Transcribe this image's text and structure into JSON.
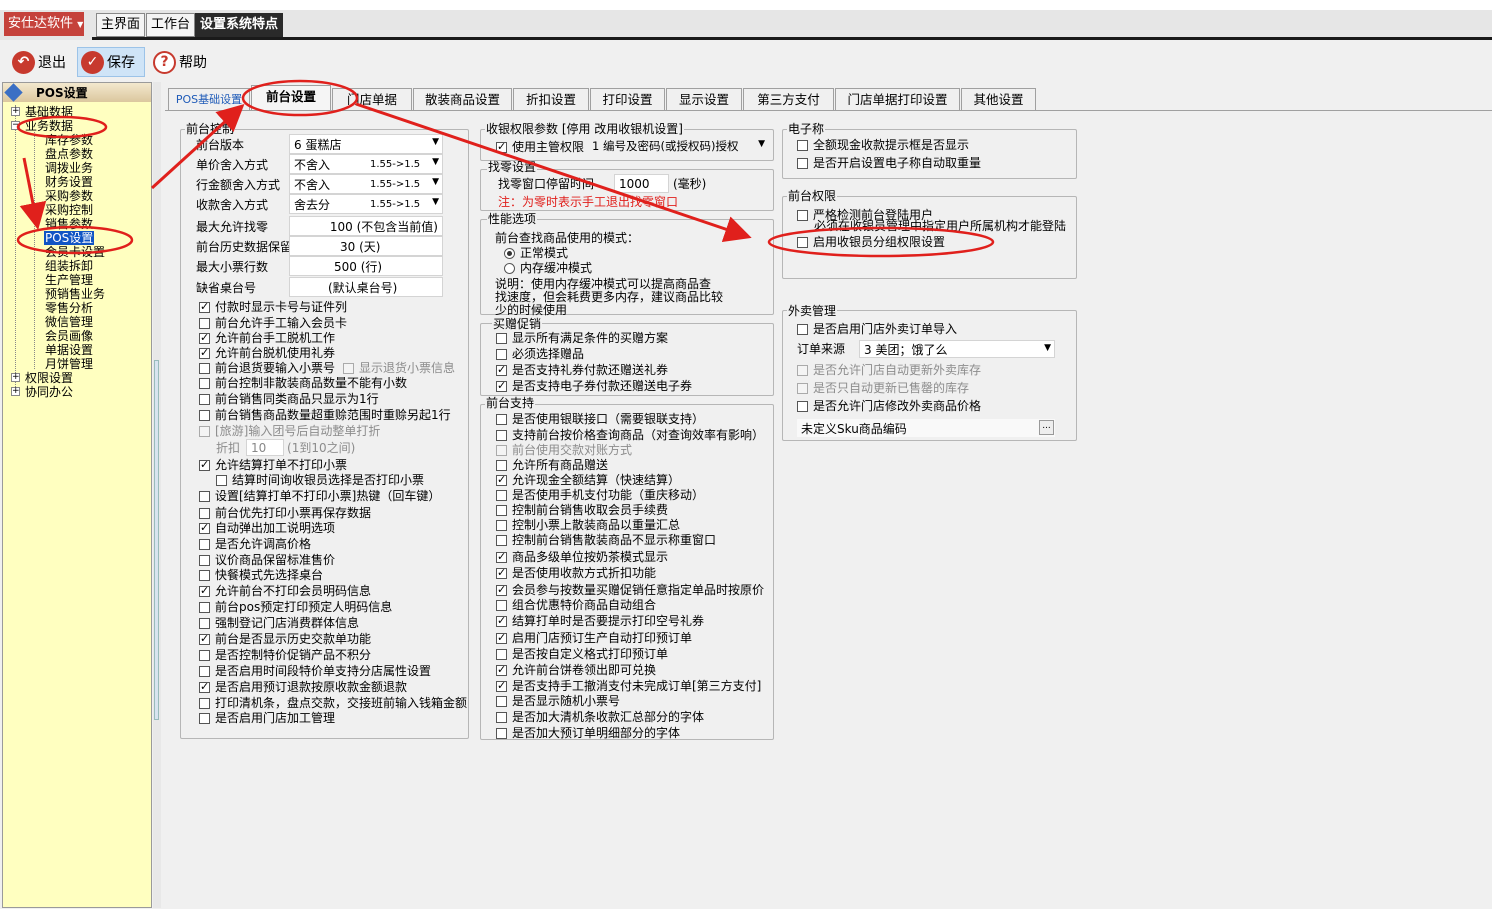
{
  "title_bar": {
    "text": ""
  },
  "brand": {
    "label": "安仕达软件"
  },
  "module_tabs": [
    {
      "label": "主界面"
    },
    {
      "label": "工作台"
    },
    {
      "label": "设置系统特点"
    }
  ],
  "toolbar": {
    "exit": "退出",
    "save": "保存",
    "help": "帮助"
  },
  "sidebar": {
    "title": "POS设置",
    "items": [
      {
        "label": "基础数据"
      },
      {
        "label": "业务数据"
      },
      {
        "label": "库存参数"
      },
      {
        "label": "盘点参数"
      },
      {
        "label": "调拨业务"
      },
      {
        "label": "财务设置"
      },
      {
        "label": "采购参数"
      },
      {
        "label": "采购控制"
      },
      {
        "label": "销售参数"
      },
      {
        "label": "POS设置"
      },
      {
        "label": "会员卡设置"
      },
      {
        "label": "组装拆卸"
      },
      {
        "label": "生产管理"
      },
      {
        "label": "预销售业务"
      },
      {
        "label": "零售分析"
      },
      {
        "label": "微信管理"
      },
      {
        "label": "会员画像"
      },
      {
        "label": "单据设置"
      },
      {
        "label": "月饼管理"
      },
      {
        "label": "权限设置"
      },
      {
        "label": "协同办公"
      }
    ]
  },
  "tabs": [
    {
      "label": "POS基础设置"
    },
    {
      "label": "前台设置"
    },
    {
      "label": "门店单据"
    },
    {
      "label": "散装商品设置"
    },
    {
      "label": "折扣设置"
    },
    {
      "label": "打印设置"
    },
    {
      "label": "显示设置"
    },
    {
      "label": "第三方支付"
    },
    {
      "label": "门店单据打印设置"
    },
    {
      "label": "其他设置"
    }
  ],
  "front_control": {
    "title": "前台控制",
    "fields": [
      {
        "label": "前台版本",
        "value": "6 蛋糕店",
        "extra": ""
      },
      {
        "label": "单价舍入方式",
        "value": "不舍入",
        "extra": "1.55->1.5"
      },
      {
        "label": "行金额舍入方式",
        "value": "不舍入",
        "extra": "1.55->1.5"
      },
      {
        "label": "收款舍入方式",
        "value": "舍去分",
        "extra": "1.55->1.5"
      },
      {
        "label": "最大允许找零",
        "value": "100 (不包含当前值)"
      },
      {
        "label": "前台历史数据保留",
        "value": "30 (天)"
      },
      {
        "label": "最大小票行数",
        "value": "500 (行)"
      },
      {
        "label": "缺省桌台号",
        "value": "(默认桌台号)"
      }
    ],
    "checks": [
      {
        "label": "付款时显示卡号与证件列",
        "checked": true
      },
      {
        "label": "前台允许手工输入会员卡",
        "checked": false
      },
      {
        "label": "允许前台手工脱机工作",
        "checked": true
      },
      {
        "label": "允许前台脱机使用礼券",
        "checked": true
      },
      {
        "label": "前台退货要输入小票号",
        "checked": false
      },
      {
        "label": "显示退货小票信息",
        "checked": false
      },
      {
        "label": "前台控制非散装商品数量不能有小数",
        "checked": false
      },
      {
        "label": "前台销售同类商品只显示为1行",
        "checked": false
      },
      {
        "label": "前台销售商品数量超重赊范围时重赊另起1行",
        "checked": false
      },
      {
        "label": "[旅游]输入团号后自动整单打折",
        "checked": false
      },
      {
        "label": "允许结算打单不打印小票",
        "checked": true
      },
      {
        "label": "结算时间询收银员选择是否打印小票",
        "checked": false
      },
      {
        "label": "设置[结算打单不打印小票]热键（回车键）",
        "checked": false
      },
      {
        "label": "前台优先打印小票再保存数据",
        "checked": false
      },
      {
        "label": "自动弹出加工说明选项",
        "checked": true
      },
      {
        "label": "是否允许调高价格",
        "checked": false
      },
      {
        "label": "议价商品保留标准售价",
        "checked": false
      },
      {
        "label": "快餐模式先选择桌台",
        "checked": false
      },
      {
        "label": "允许前台不打印会员明码信息",
        "checked": true
      },
      {
        "label": "前台pos预定打印预定人明码信息",
        "checked": false
      },
      {
        "label": "强制登记门店消费群体信息",
        "checked": false
      },
      {
        "label": "前台是否显示历史交款单功能",
        "checked": true
      },
      {
        "label": "是否控制特价促销产品不积分",
        "checked": false
      },
      {
        "label": "是否启用时间段特价单支持分店属性设置",
        "checked": false
      },
      {
        "label": "是否启用预订退款按原收款金额退款",
        "checked": true
      },
      {
        "label": "打印清机条，盘点交款，交接班前输入钱箱金额",
        "checked": false
      },
      {
        "label": "是否启用门店加工管理",
        "checked": false
      }
    ],
    "discount": {
      "label": "折扣",
      "value": "10",
      "hint": "(1到10之间)"
    }
  },
  "cashier_perm": {
    "title": "收银权限参数 [停用  改用收银机设置]",
    "label": "使用主管权限",
    "checked": true,
    "value": "1 编号及密码(或授权码)授权"
  },
  "change": {
    "title": "找零设置",
    "label": "找零窗口停留时间",
    "value": "1000",
    "unit": "(毫秒)",
    "note": "注：为零时表示手工退出找零窗口"
  },
  "perf": {
    "title": "性能选项",
    "desc": "前台查找商品使用的模式：",
    "options": [
      {
        "label": "正常模式",
        "selected": true
      },
      {
        "label": "内存缓冲模式",
        "selected": false
      }
    ],
    "note": [
      "说明：使用内存缓冲模式可以提高商品查",
      "找速度，但会耗费更多内存，建议商品比较",
      "少的时候使用"
    ]
  },
  "gift_promo": {
    "title": "买赠促销",
    "checks": [
      {
        "label": "显示所有满足条件的买赠方案",
        "checked": false
      },
      {
        "label": "必须选择赠品",
        "checked": false
      },
      {
        "label": "是否支持礼券付款还赠送礼券",
        "checked": true
      },
      {
        "label": "是否支持电子券付款还赠送电子券",
        "checked": true
      }
    ]
  },
  "front_support": {
    "title": "前台支持",
    "checks": [
      {
        "label": "是否使用银联接口（需要银联支持）",
        "checked": false,
        "disabled": false
      },
      {
        "label": "支持前台按价格查询商品（对查询效率有影响）",
        "checked": false,
        "disabled": false
      },
      {
        "label": "前台使用交款对账方式",
        "checked": false,
        "disabled": true
      },
      {
        "label": "允许所有商品赠送",
        "checked": false,
        "disabled": false
      },
      {
        "label": "允许现金全额结算（快速结算）",
        "checked": true,
        "disabled": false
      },
      {
        "label": "是否使用手机支付功能（重庆移动）",
        "checked": false,
        "disabled": false
      },
      {
        "label": "控制前台销售收取会员手续费",
        "checked": false,
        "disabled": false
      },
      {
        "label": "控制小票上散装商品以重量汇总",
        "checked": false,
        "disabled": false
      },
      {
        "label": "控制前台销售散装商品不显示称重窗口",
        "checked": false,
        "disabled": false
      },
      {
        "label": "商品多级单位按奶茶模式显示",
        "checked": true,
        "disabled": false
      },
      {
        "label": "是否使用收款方式折扣功能",
        "checked": true,
        "disabled": false
      },
      {
        "label": "会员参与按数量买赠促销任意指定单品时按原价",
        "checked": true,
        "disabled": false
      },
      {
        "label": "组合优惠特价商品自动组合",
        "checked": false,
        "disabled": false
      },
      {
        "label": "结算打单时是否要提示打印空号礼券",
        "checked": true,
        "disabled": false
      },
      {
        "label": "启用门店预订生产自动打印预订单",
        "checked": true,
        "disabled": false
      },
      {
        "label": "是否按自定义格式打印预订单",
        "checked": false,
        "disabled": false
      },
      {
        "label": "允许前台饼卷领出即可兑换",
        "checked": true,
        "disabled": false
      },
      {
        "label": "是否支持手工撤消支付未完成订单[第三方支付]",
        "checked": true,
        "disabled": false
      },
      {
        "label": "是否显示随机小票号",
        "checked": false,
        "disabled": false
      },
      {
        "label": "是否加大清机条收款汇总部分的字体",
        "checked": false,
        "disabled": false
      },
      {
        "label": "是否加大预订单明细部分的字体",
        "checked": false,
        "disabled": false
      }
    ]
  },
  "scale": {
    "title": "电子称",
    "checks": [
      {
        "label": "全额现金收款提示框是否显示",
        "checked": false
      },
      {
        "label": "是否开启设置电子称自动取重量",
        "checked": false
      }
    ]
  },
  "front_perm": {
    "title": "前台权限",
    "checks": [
      {
        "label": "严格检测前台登陆用户",
        "checked": false
      },
      {
        "label": "启用收银员分组权限设置",
        "checked": false
      }
    ],
    "note": "必须在收银员管理中指定用户所属机构才能登陆"
  },
  "takeout": {
    "title": "外卖管理",
    "import": {
      "label": "是否启用门店外卖订单导入",
      "checked": false
    },
    "order_source": {
      "label": "订单来源",
      "value": "3 美团；饿了么"
    },
    "checks": [
      {
        "label": "是否允许门店自动更新外卖库存",
        "checked": false,
        "disabled": true
      },
      {
        "label": "是否只自动更新已售罄的库存",
        "checked": false,
        "disabled": true
      },
      {
        "label": "是否允许门店修改外卖商品价格",
        "checked": false,
        "disabled": false
      }
    ],
    "sku": {
      "value": "未定义Sku商品编码",
      "btn": "..."
    }
  },
  "colors": {
    "brand": "#c5423b",
    "annotation": "#e0201c",
    "selection": "#1055c4",
    "sidebar": "#ffffc0"
  }
}
